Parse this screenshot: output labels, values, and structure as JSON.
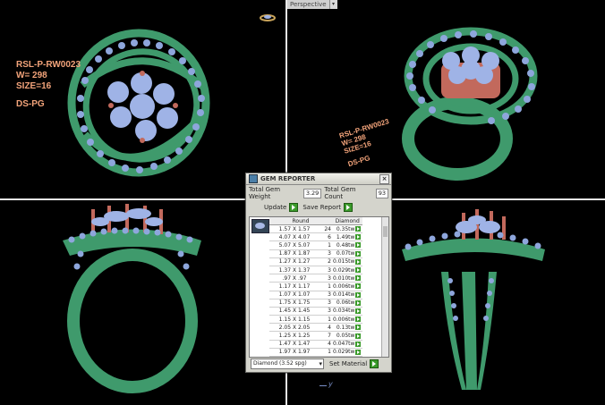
{
  "viewport": {
    "label": "Perspective"
  },
  "labels": {
    "top_left": {
      "line1": "RSL-P-RW0023",
      "line2": "W= 298",
      "line3": "SIZE=16",
      "line4": "DS-PG"
    },
    "top_right": {
      "line1": "RSL-P-RW0023",
      "line2": "W= 298",
      "line3": "SIZE=16",
      "line4": "DS-PG"
    }
  },
  "gem_reporter": {
    "title": "GEM REPORTER",
    "total_weight_label": "Total Gem Weight",
    "total_weight_value": "3.29",
    "total_count_label": "Total Gem Count",
    "total_count_value": "93",
    "update_label": "Update",
    "save_report_label": "Save Report",
    "col_shape": "Round",
    "col_material": "Diamond",
    "rows": [
      {
        "size": "1.57 X 1.57",
        "count": "24",
        "weight": "0.35tw"
      },
      {
        "size": "4.07 X 4.07",
        "count": "6",
        "weight": "1.49tw"
      },
      {
        "size": "5.07 X 5.07",
        "count": "1",
        "weight": "0.48tw"
      },
      {
        "size": "1.87 X 1.87",
        "count": "3",
        "weight": "0.07tw"
      },
      {
        "size": "1.27 X 1.27",
        "count": "2",
        "weight": "0.015tw"
      },
      {
        "size": "1.37 X 1.37",
        "count": "3",
        "weight": "0.029tw"
      },
      {
        "size": ".97 X .97",
        "count": "3",
        "weight": "0.010tw"
      },
      {
        "size": "1.17 X 1.17",
        "count": "1",
        "weight": "0.006tw"
      },
      {
        "size": "1.07 X 1.07",
        "count": "3",
        "weight": "0.014tw"
      },
      {
        "size": "1.75 X 1.75",
        "count": "3",
        "weight": "0.06tw"
      },
      {
        "size": "1.45 X 1.45",
        "count": "3",
        "weight": "0.034tw"
      },
      {
        "size": "1.15 X 1.15",
        "count": "1",
        "weight": "0.006tw"
      },
      {
        "size": "2.05 X 2.05",
        "count": "4",
        "weight": "0.13tw"
      },
      {
        "size": "1.25 X 1.25",
        "count": "7",
        "weight": "0.05tw"
      },
      {
        "size": "1.47 X 1.47",
        "count": "4",
        "weight": "0.047tw"
      },
      {
        "size": "1.97 X 1.97",
        "count": "1",
        "weight": "0.029tw"
      },
      {
        "size": "2.17 X 2.17",
        "count": "1",
        "weight": "0.038tw"
      }
    ],
    "material_select": "Diamond",
    "material_sg": "(3.52 spg)",
    "set_material_label": "Set Material"
  },
  "axis": {
    "y_label": "y"
  },
  "colors": {
    "metal": "#3f9a6c",
    "gem": "#9fb3e6",
    "prong": "#c2695c",
    "label": "#f2a37a"
  }
}
